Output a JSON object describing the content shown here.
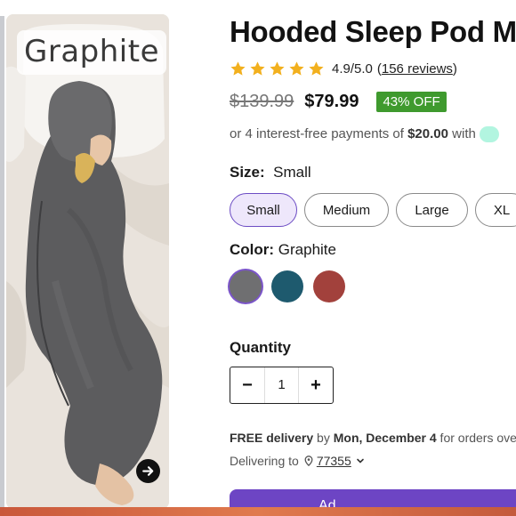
{
  "gallery": {
    "image_alt": "Person sleeping in a graphite hooded sleep pod",
    "color_badge": "Graphite"
  },
  "product": {
    "title": "Hooded Sleep Pod M",
    "rating": {
      "stars": 5,
      "value_text": "4.9/5.0",
      "reviews_link": "156 reviews"
    },
    "price": {
      "original": "$139.99",
      "sale": "$79.99",
      "discount": "43% OFF"
    },
    "installments": {
      "prefix": "or 4 interest-free payments of ",
      "amount": "$20.00",
      "suffix": " with"
    },
    "size": {
      "label": "Size:",
      "selected": "Small",
      "options": [
        "Small",
        "Medium",
        "Large",
        "XL"
      ]
    },
    "color": {
      "label": "Color:",
      "selected": "Graphite",
      "swatches": [
        {
          "name": "Graphite",
          "hex": "#6f6f71"
        },
        {
          "name": "Teal",
          "hex": "#1e5a6e"
        },
        {
          "name": "Red",
          "hex": "#a2413c"
        }
      ]
    },
    "quantity": {
      "label": "Quantity",
      "value": "1",
      "minus": "−",
      "plus": "+"
    },
    "delivery": {
      "free": "FREE delivery",
      "by": " by ",
      "date": "Mon, December 4",
      "suffix": " for orders ove"
    },
    "delivering_to": {
      "label": "Delivering to",
      "zip": "77355"
    },
    "add_to_cart": "Ad"
  },
  "colors": {
    "accent": "#6d45c4",
    "discount": "#3f9a2e",
    "star": "#f2b01e"
  }
}
